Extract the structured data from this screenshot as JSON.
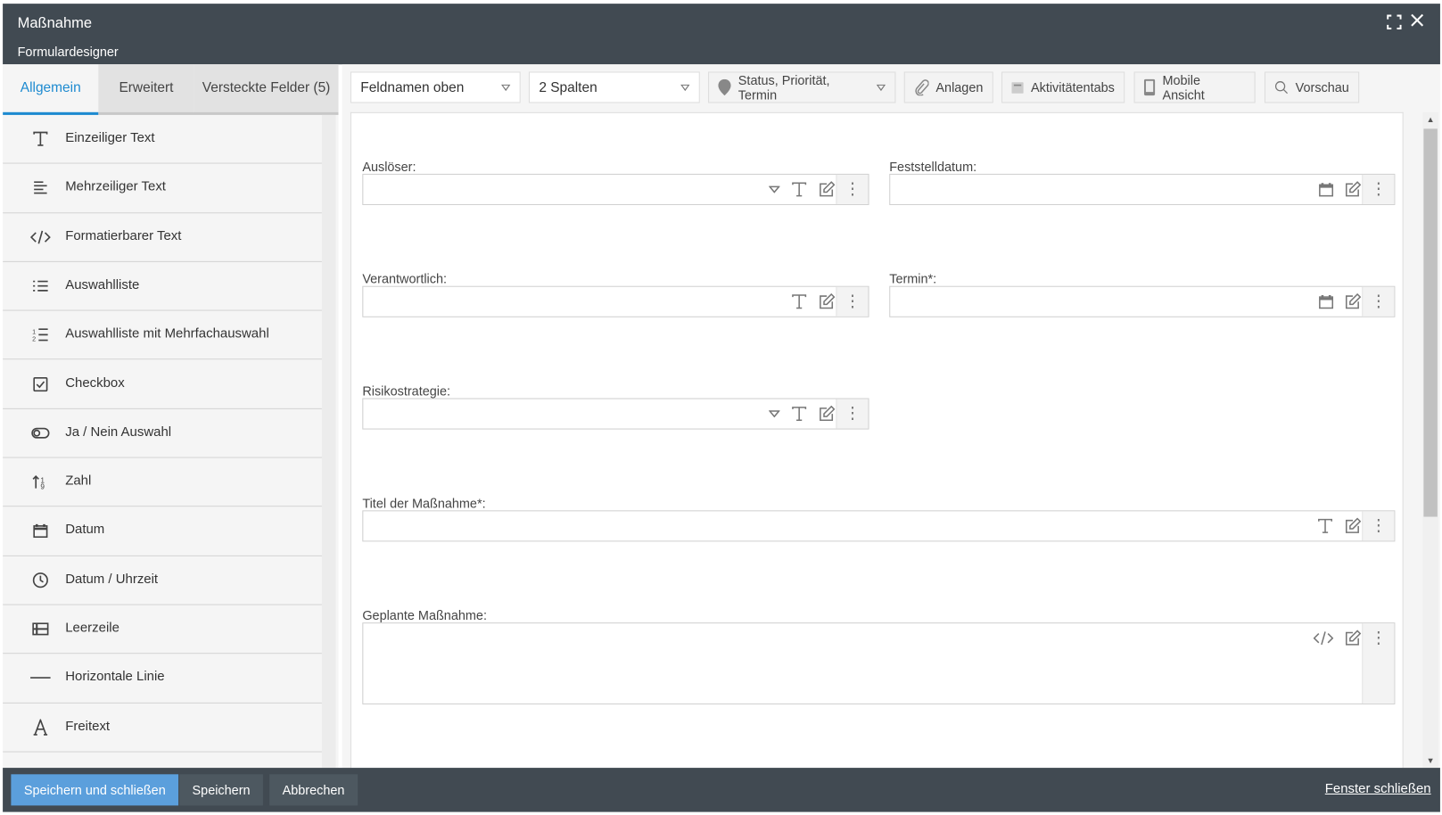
{
  "window": {
    "title": "Maßnahme",
    "subtitle": "Formulardesigner"
  },
  "tabs": [
    {
      "label": "Allgemein",
      "active": true
    },
    {
      "label": "Erweitert"
    },
    {
      "label": "Versteckte Felder (5)"
    }
  ],
  "palette": [
    {
      "label": "Einzeiliger Text",
      "icon": "text-t-icon"
    },
    {
      "label": "Mehrzeiliger Text",
      "icon": "align-left-icon"
    },
    {
      "label": "Formatierbarer Text",
      "icon": "code-icon"
    },
    {
      "label": "Auswahlliste",
      "icon": "list-icon"
    },
    {
      "label": "Auswahlliste mit Mehrfachauswahl",
      "icon": "ordered-list-icon"
    },
    {
      "label": "Checkbox",
      "icon": "checkbox-icon"
    },
    {
      "label": "Ja / Nein Auswahl",
      "icon": "toggle-icon"
    },
    {
      "label": "Zahl",
      "icon": "number-sort-icon"
    },
    {
      "label": "Datum",
      "icon": "calendar-icon"
    },
    {
      "label": "Datum / Uhrzeit",
      "icon": "clock-icon"
    },
    {
      "label": "Leerzeile",
      "icon": "empty-row-icon"
    },
    {
      "label": "Horizontale Linie",
      "icon": "horizontal-line-icon"
    },
    {
      "label": "Freitext",
      "icon": "letter-a-icon"
    }
  ],
  "toolbar": {
    "label_position": "Feldnamen oben",
    "columns": "2 Spalten",
    "status": "Status, Priorität, Termin",
    "attachments": "Anlagen",
    "activity_tabs": "Aktivitätentabs",
    "mobile": "Mobile Ansicht",
    "preview": "Vorschau"
  },
  "fields": [
    {
      "label": "Auslöser:",
      "type": "select"
    },
    {
      "label": "Feststelldatum:",
      "type": "date"
    },
    {
      "label": "Verantwortlich:",
      "type": "text"
    },
    {
      "label": "Termin*:",
      "type": "date"
    },
    {
      "label": "Risikostrategie:",
      "type": "select"
    },
    {
      "label": "Titel der Maßnahme*:",
      "type": "text"
    },
    {
      "label": "Geplante Maßnahme:",
      "type": "richtext"
    }
  ],
  "footer": {
    "save_close": "Speichern und schließen",
    "save": "Speichern",
    "cancel": "Abbrechen",
    "close_window": "Fenster schließen"
  },
  "colors": {
    "header": "#414a52",
    "accent": "#1d8ad0",
    "primary_button": "#5b9fdc"
  }
}
